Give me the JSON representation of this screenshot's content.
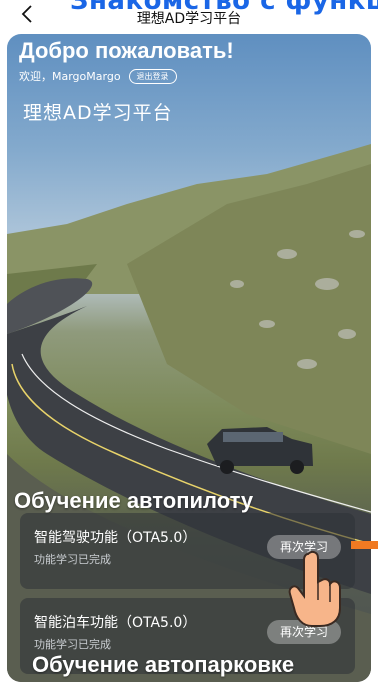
{
  "top_overlay": {
    "text": "Знакомство с функцией"
  },
  "nav": {
    "title": "理想AD学习平台"
  },
  "hero": {
    "welcome": "Добро пожаловать!",
    "greeting": "欢迎，MargoMargo",
    "logout_label": "退出登录",
    "brand": "理想AD学习平台"
  },
  "captions": {
    "autopilot": "Обучение автопилоту",
    "autoparking": "Обучение автопарковке"
  },
  "cards": [
    {
      "title": "智能驾驶功能（OTA5.0）",
      "status": "功能学习已完成",
      "button": "再次学习"
    },
    {
      "title": "智能泊车功能（OTA5.0）",
      "status": "功能学习已完成",
      "button": "再次学习"
    }
  ],
  "colors": {
    "overlay_text": "#1a66e6",
    "arrow": "#f07a22"
  }
}
